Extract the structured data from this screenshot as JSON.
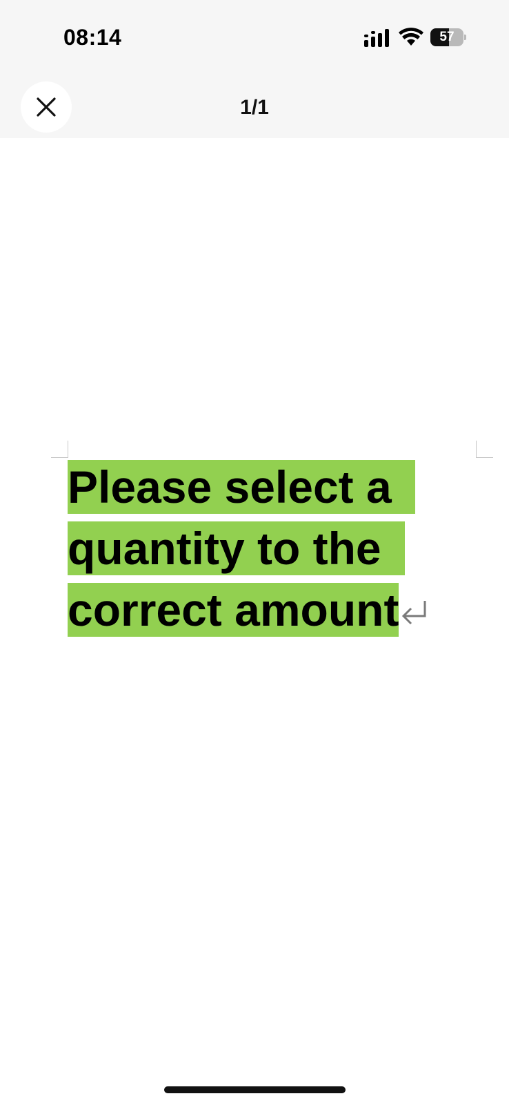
{
  "status_bar": {
    "time": "08:14",
    "battery_level": "57",
    "battery_fraction": 0.57,
    "icons": [
      "signal-icon",
      "wifi-icon",
      "battery-icon"
    ]
  },
  "header": {
    "page_indicator": "1/1",
    "close_icon": "close-icon"
  },
  "document": {
    "lines": [
      "Please select a",
      "quantity to the",
      "correct amount"
    ],
    "highlight_color": "#92d050",
    "paragraph_mark": "paragraph-mark-icon"
  }
}
